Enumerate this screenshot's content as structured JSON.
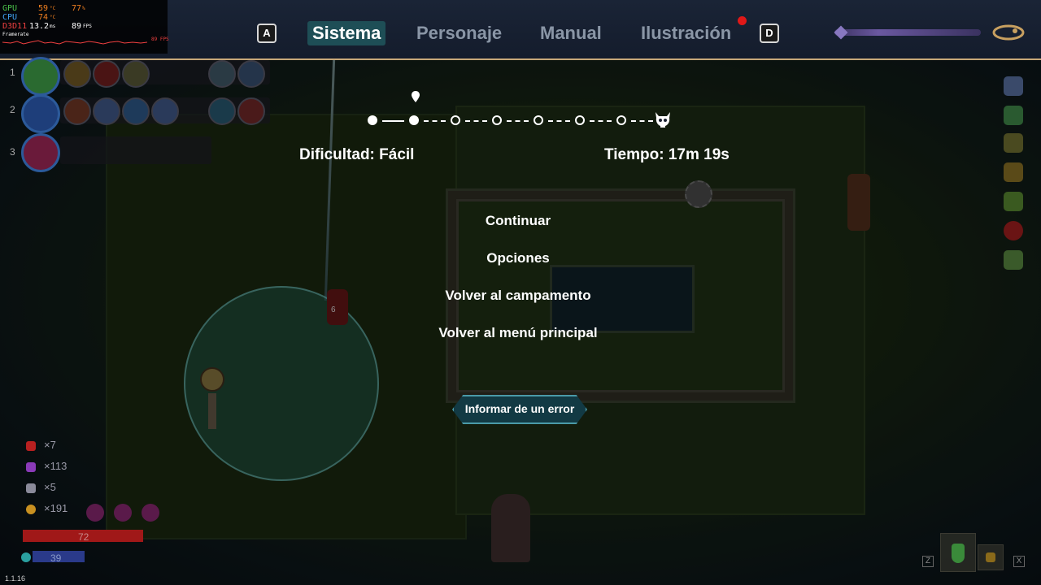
{
  "tabs": {
    "prev_key": "A",
    "next_key": "D",
    "items": [
      {
        "label": "Sistema",
        "active": true
      },
      {
        "label": "Personaje",
        "active": false
      },
      {
        "label": "Manual",
        "active": false
      },
      {
        "label": "Ilustración",
        "active": false
      }
    ]
  },
  "perf_overlay": {
    "gpu_label": "GPU",
    "gpu_temp": "59",
    "gpu_unit": "°C",
    "gpu_usage": "77",
    "gpu_usage_unit": "%",
    "cpu_label": "CPU",
    "cpu_temp": "74",
    "cpu_unit": "°C",
    "api_label": "D3D11",
    "frametime": "13.2",
    "frametime_unit": "ms",
    "fps": "89",
    "fps_unit": "FPS",
    "graph_label": "Framerate",
    "graph_max": "89 FPS"
  },
  "progress": {
    "difficulty": "Dificultad: Fácil",
    "time": "Tiempo: 17m 19s",
    "current_stage": 2,
    "total_stages": 7
  },
  "menu": {
    "continue": "Continuar",
    "options": "Opciones",
    "camp": "Volver al campamento",
    "main_menu": "Volver al menú principal",
    "report": "Informar de un error"
  },
  "hud": {
    "row1": "1",
    "row2": "2",
    "row3": "3",
    "resources": [
      {
        "icon": "red-gem-icon",
        "value": "×7",
        "color": "#b82020"
      },
      {
        "icon": "purple-crystal-icon",
        "value": "×113",
        "color": "#8a3ab8"
      },
      {
        "icon": "key-icon",
        "value": "×5",
        "color": "#8a8a9a"
      },
      {
        "icon": "coin-icon",
        "value": "×191",
        "color": "#c89020"
      }
    ],
    "hp": "72",
    "hp_fraction": 1.0,
    "mana": "39",
    "mana_fraction": 1.0,
    "damage_number": "6",
    "key_z": "Z",
    "key_x": "X",
    "version": "1.1.16"
  },
  "colors": {
    "tab_active_bg": "#1e4e56",
    "accent_border": "#c8a878",
    "notification": "#e01818"
  }
}
